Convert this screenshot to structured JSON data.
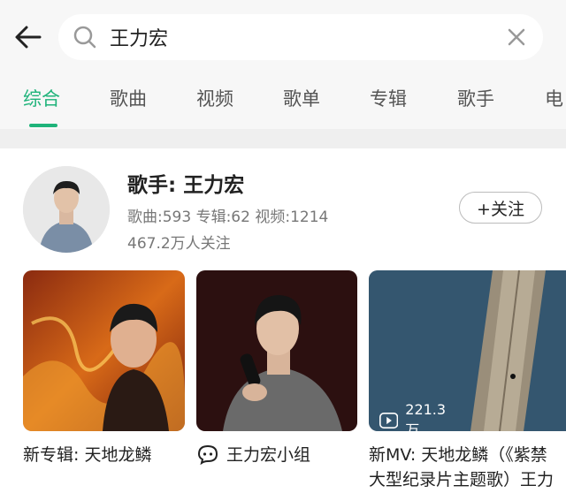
{
  "search": {
    "query": "王力宏"
  },
  "tabs": [
    {
      "label": "综合"
    },
    {
      "label": "歌曲"
    },
    {
      "label": "视频"
    },
    {
      "label": "歌单"
    },
    {
      "label": "专辑"
    },
    {
      "label": "歌手"
    },
    {
      "label": "电"
    }
  ],
  "artist": {
    "name": "歌手: 王力宏",
    "stats": "歌曲:593 专辑:62 视频:1214",
    "followers": "467.2万人关注",
    "follow_label": "+关注"
  },
  "cards": [
    {
      "caption": "新专辑: 天地龙鳞"
    },
    {
      "caption": "王力宏小组"
    },
    {
      "caption_line1": "新MV: 天地龙鳞（《紫禁",
      "caption_line2": "大型纪录片主题歌）王力",
      "play_count": "221.3万"
    }
  ],
  "colors": {
    "accent": "#1fb37a"
  }
}
